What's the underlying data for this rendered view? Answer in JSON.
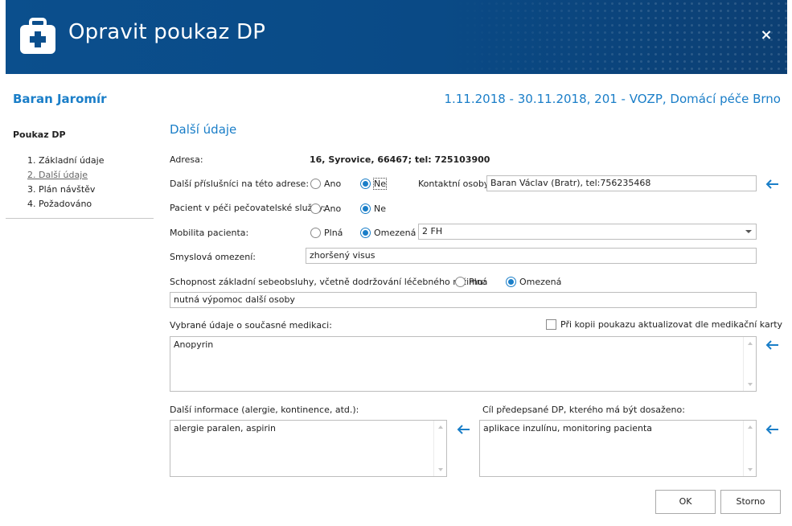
{
  "window": {
    "title": "Opravit poukaz DP",
    "close_glyph": "×"
  },
  "patient": {
    "name": "Baran Jaromír",
    "period": "1.11.2018 - 30.11.2018, 201 - VOZP, Domácí péče Brno"
  },
  "sidebar": {
    "title": "Poukaz DP",
    "items": [
      {
        "label": "1. Základní údaje",
        "active": false
      },
      {
        "label": "2. Další údaje",
        "active": true
      },
      {
        "label": "3. Plán návštěv",
        "active": false
      },
      {
        "label": "4. Požadováno",
        "active": false
      }
    ]
  },
  "form": {
    "section_title": "Další údaje",
    "address": {
      "label": "Adresa:",
      "value": "16, Syrovice, 66467; tel: 725103900"
    },
    "other_members": {
      "label": "Další příslušníci na této adrese:",
      "option_yes": "Ano",
      "option_no": "Ne",
      "selected": "Ne"
    },
    "contacts": {
      "label": "Kontaktní osoby:",
      "value": "Baran Václav (Bratr), tel:756235468"
    },
    "care_service": {
      "label": "Pacient v péči pečovatelské služby:",
      "option_yes": "Ano",
      "option_no": "Ne",
      "selected": "Ne"
    },
    "mobility": {
      "label": "Mobilita pacienta:",
      "option_full": "Plná",
      "option_limited": "Omezená",
      "selected": "Omezená",
      "detail_value": "2 FH"
    },
    "sensory": {
      "label": "Smyslová omezení:",
      "value": "zhoršený visus"
    },
    "self_care": {
      "label": "Schopnost základní sebeobsluhy, včetně dodržování léčebného režimu:",
      "option_full": "Plná",
      "option_limited": "Omezená",
      "selected": "Omezená",
      "value": "nutná výpomoc další osoby"
    },
    "medication": {
      "label": "Vybrané údaje o současné medikaci:",
      "checkbox_label": "Při kopii poukazu aktualizovat dle medikační karty",
      "checkbox_checked": false,
      "value": "Anopyrin"
    },
    "other_info": {
      "label": "Další informace (alergie, kontinence, atd.):",
      "value": "alergie paralen, aspirin"
    },
    "goal": {
      "label": "Cíl předepsané DP, kterého má být dosaženo:",
      "value": "aplikace inzulínu, monitoring pacienta"
    }
  },
  "buttons": {
    "ok": "OK",
    "cancel": "Storno"
  },
  "colors": {
    "header_bg": "#0b4f8d",
    "accent": "#1a7ec8"
  }
}
